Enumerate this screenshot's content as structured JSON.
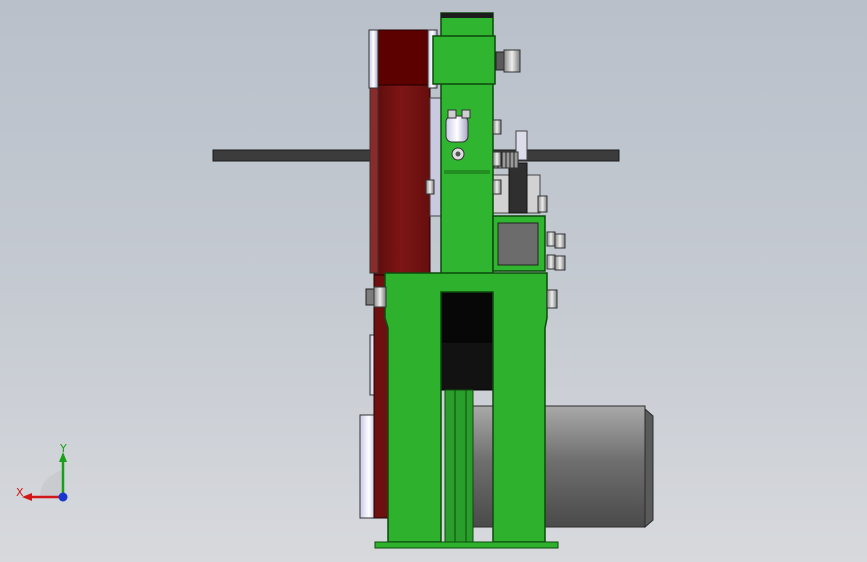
{
  "viewport": {
    "background_top": "#b9c0ca",
    "background_bottom": "#d7d9dd"
  },
  "model": {
    "colors": {
      "frame_green": "#2fb22f",
      "frame_green_light": "#3ed03e",
      "belt_red": "#7a1414",
      "motor_gray": "#7e7e7e",
      "rod_dark": "#3a3a3a",
      "spacer_black": "#101010"
    },
    "parts": [
      "frame-upright-icon",
      "frame-base-icon",
      "sanding-belt-icon",
      "drive-wheel-icon",
      "motor-housing-icon",
      "work-rest-rod-icon",
      "tension-spring-icon",
      "hex-bolt-icon"
    ]
  },
  "triad": {
    "x_label": "X",
    "y_label": "Y",
    "x_color": "#d01818",
    "y_color": "#18a018",
    "z_color": "#1838d0"
  }
}
